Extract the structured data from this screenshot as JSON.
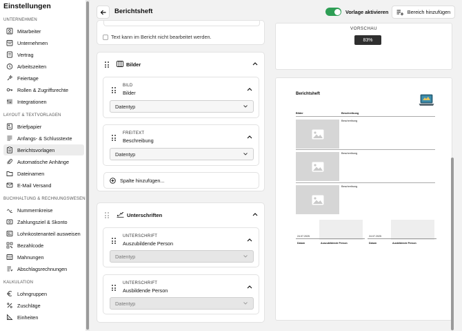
{
  "sidebar": {
    "title": "Einstellungen",
    "sections": [
      {
        "label": "UNTERNEHMEN"
      },
      {
        "label": "LAYOUT & TEXTVORLAGEN"
      },
      {
        "label": "BUCHHALTUNG & RECHNUNGSWESEN"
      },
      {
        "label": "KALKULATION"
      }
    ],
    "items": [
      {
        "label": "Mitarbeiter",
        "icon": "users-icon"
      },
      {
        "label": "Unternehmen",
        "icon": "building-icon"
      },
      {
        "label": "Vertrag",
        "icon": "contract-icon"
      },
      {
        "label": "Arbeitszeiten",
        "icon": "clock-icon"
      },
      {
        "label": "Feiertage",
        "icon": "sparkle-icon"
      },
      {
        "label": "Rollen & Zugriffsrechte",
        "icon": "key-icon"
      },
      {
        "label": "Integrationen",
        "icon": "integrations-icon"
      },
      {
        "label": "Briefpapier",
        "icon": "letterhead-icon"
      },
      {
        "label": "Anfangs- & Schlusstexte",
        "icon": "text-icon"
      },
      {
        "label": "Berichtsvorlagen",
        "icon": "clipboard-icon"
      },
      {
        "label": "Automatische Anhänge",
        "icon": "paperclip-icon"
      },
      {
        "label": "Dateinamen",
        "icon": "folder-icon"
      },
      {
        "label": "E-Mail Versand",
        "icon": "mail-icon"
      },
      {
        "label": "Nummernkreise",
        "icon": "number-icon"
      },
      {
        "label": "Zahlungsziel & Skonto",
        "icon": "payment-icon"
      },
      {
        "label": "Lohnkostenanteil ausweisen",
        "icon": "wage-icon"
      },
      {
        "label": "Bezahlcode",
        "icon": "qr-icon"
      },
      {
        "label": "Mahnungen",
        "icon": "reminder-icon"
      },
      {
        "label": "Abschlagsrechnungen",
        "icon": "installment-icon"
      },
      {
        "label": "Lohngruppen",
        "icon": "euro-icon"
      },
      {
        "label": "Zuschläge",
        "icon": "percent-icon"
      },
      {
        "label": "Einheiten",
        "icon": "ruler-icon"
      }
    ],
    "active_item": "Berichtsvorlagen"
  },
  "header": {
    "title": "Berichtsheft",
    "toggle_label": "Vorlage aktivieren",
    "toggle_on": true,
    "add_area_label": "Bereich hinzufügen"
  },
  "editor": {
    "locked_text_label": "Text kann im Bericht nicht bearbeitet werden.",
    "images_section": {
      "title": "Bilder",
      "columns": [
        {
          "type": "BILD",
          "name": "Bilder",
          "select": "Datentyp"
        },
        {
          "type": "FREITEXT",
          "name": "Beschreibung",
          "select": "Datentyp"
        }
      ],
      "add_column_label": "Spalte hinzufügen..."
    },
    "signatures_section": {
      "title": "Unterschriften",
      "columns": [
        {
          "type": "UNTERSCHRIFT",
          "name": "Auszubildende Person",
          "select": "Datentyp"
        },
        {
          "type": "UNTERSCHRIFT",
          "name": "Ausbildende Person",
          "select": "Datentyp"
        }
      ]
    }
  },
  "preview": {
    "label": "VORSCHAU",
    "zoom": "83%",
    "doc": {
      "title": "Berichtsheft",
      "col_images": "Bilder",
      "col_description": "Beschreibung",
      "rows": [
        "Beschreibung",
        "Beschreibung",
        "Beschreibung"
      ],
      "sig_left": {
        "date": "24.07.2025",
        "date_label": "Datum",
        "person_label": "Auszubildende Person"
      },
      "sig_right": {
        "date": "24.07.2025",
        "date_label": "Datum",
        "person_label": "Ausbildende Person"
      }
    }
  },
  "colors": {
    "toggle": "#2e9e55",
    "active_bg": "#ececec",
    "badge": "#2f2f2f"
  }
}
